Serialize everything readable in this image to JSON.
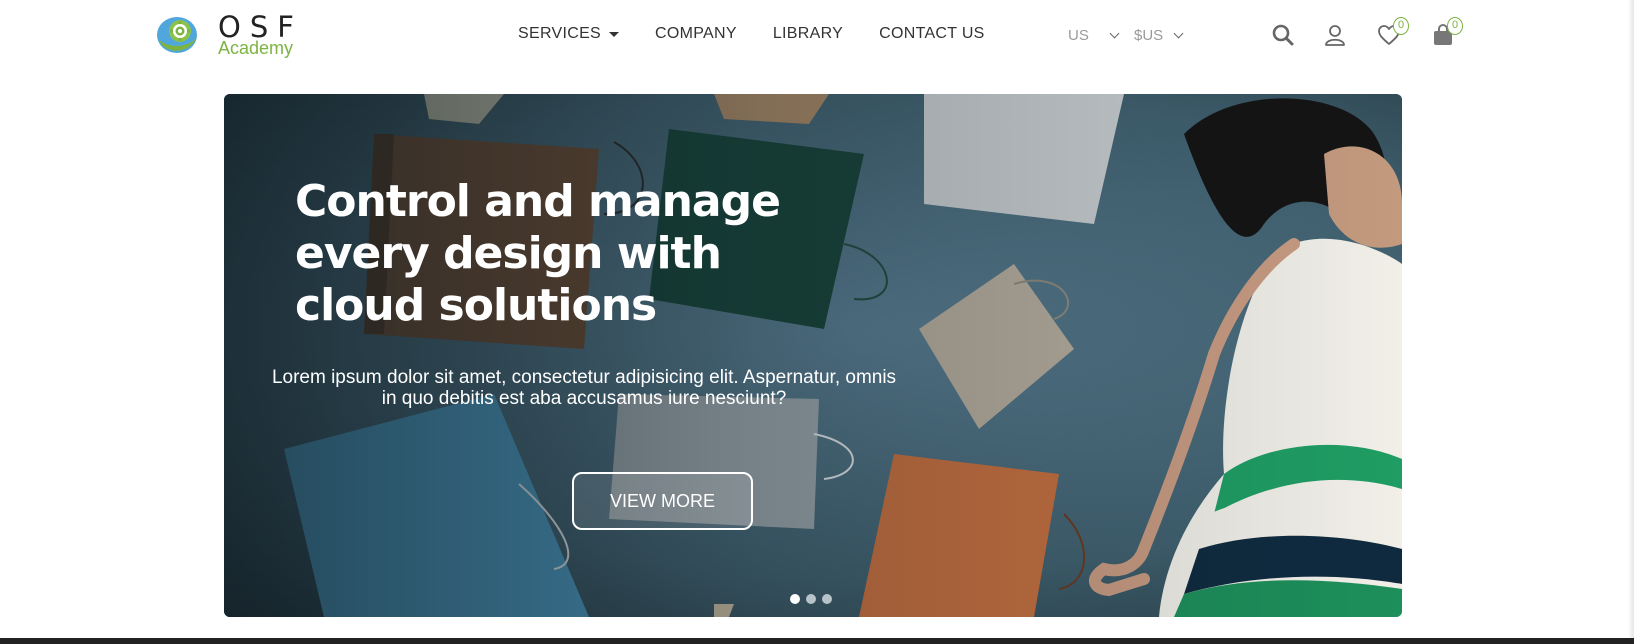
{
  "brand": {
    "name": "OSF",
    "subname": "Academy",
    "accent_color": "#7cb342"
  },
  "nav": {
    "items": [
      {
        "label": "SERVICES",
        "has_dropdown": true
      },
      {
        "label": "COMPANY",
        "has_dropdown": false
      },
      {
        "label": "LIBRARY",
        "has_dropdown": false
      },
      {
        "label": "CONTACT US",
        "has_dropdown": false
      }
    ]
  },
  "locale": {
    "country": "US",
    "currency": "$US"
  },
  "actions": {
    "search_icon": "search-icon",
    "account_icon": "user-icon",
    "wishlist_icon": "heart-icon",
    "wishlist_count": "0",
    "cart_icon": "shopping-bag-icon",
    "cart_count": "0"
  },
  "hero": {
    "title": "Control and manage every design with cloud solutions",
    "subtitle": "Lorem ipsum dolor sit amet, consectetur adipisicing elit. Aspernatur, omnis in quo debitis est aba accusamus iure nesciunt?",
    "button_label": "VIEW MORE",
    "slides_total": 3,
    "active_slide": 1
  }
}
